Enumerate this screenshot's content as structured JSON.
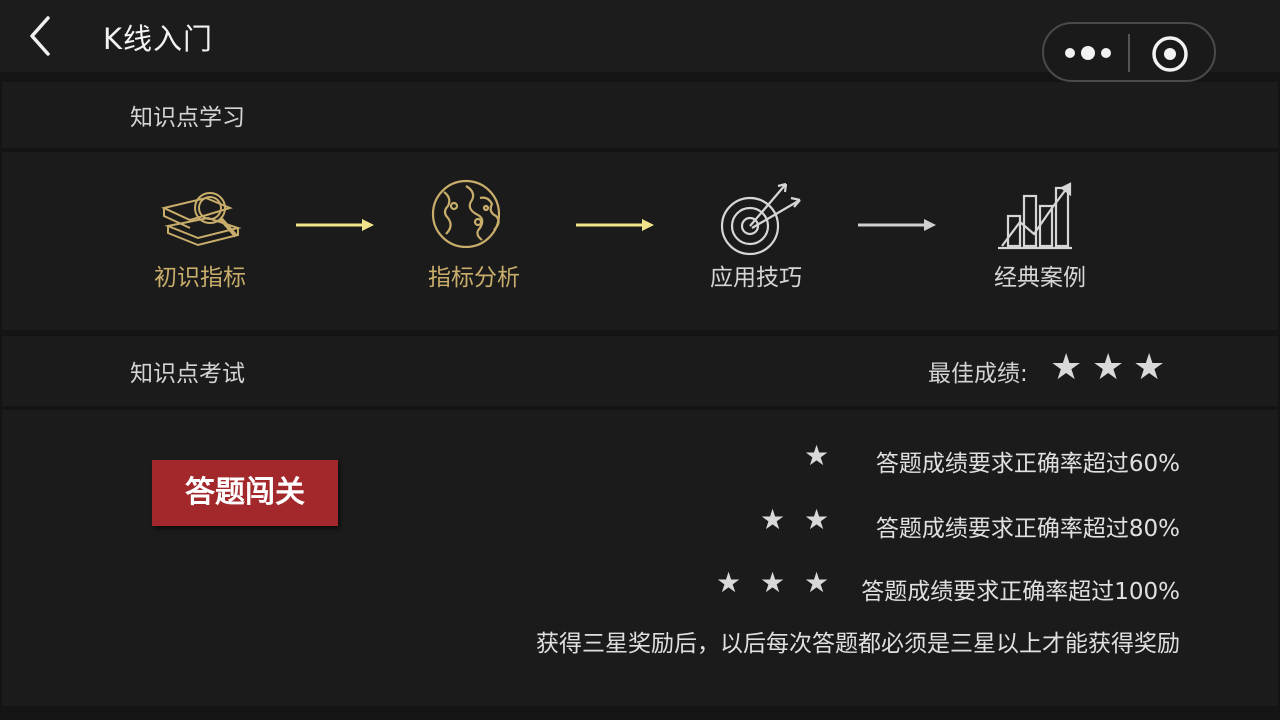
{
  "header": {
    "title": "K线入门",
    "back_icon": "chevron-left-icon",
    "more_icon": "more-dots-icon",
    "target_icon": "target-circle-icon"
  },
  "learning": {
    "section_title": "知识点学习",
    "steps": [
      {
        "label": "初识指标",
        "icon": "book-magnifier-icon",
        "color": "#c8ad6b"
      },
      {
        "label": "指标分析",
        "icon": "world-map-icon",
        "color": "#c8ad6b"
      },
      {
        "label": "应用技巧",
        "icon": "target-arrows-icon",
        "color": "#d6d6d6"
      },
      {
        "label": "经典案例",
        "icon": "bar-chart-growth-icon",
        "color": "#d6d6d6"
      }
    ],
    "arrow_colors": [
      "#f2e48a",
      "#f2e48a",
      "#cfcfcf"
    ]
  },
  "exam": {
    "section_title": "知识点考试",
    "best_label": "最佳成绩:",
    "best_stars": 3,
    "button_label": "答题闯关",
    "rules": [
      {
        "stars": 1,
        "text": "答题成绩要求正确率超过60%"
      },
      {
        "stars": 2,
        "text": "答题成绩要求正确率超过80%"
      },
      {
        "stars": 3,
        "text": "答题成绩要求正确率超过100%"
      }
    ],
    "note": "获得三星奖励后，以后每次答题都必须是三星以上才能获得奖励"
  },
  "colors": {
    "accent_button": "#a3282c",
    "gold": "#c8ad6b",
    "background": "#141414"
  }
}
